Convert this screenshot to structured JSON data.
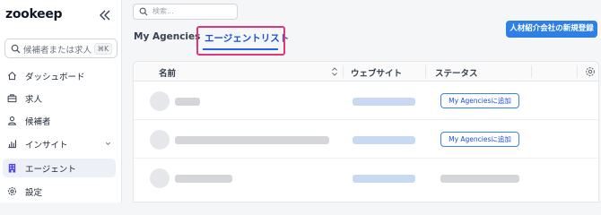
{
  "app": {
    "logo_text": "zookeep"
  },
  "sidebar": {
    "search_placeholder": "候補者または求人",
    "search_shortcut": "⌘K",
    "items": [
      {
        "label": "ダッシュボード",
        "icon": "home-icon"
      },
      {
        "label": "求人",
        "icon": "briefcase-icon"
      },
      {
        "label": "候補者",
        "icon": "person-icon"
      },
      {
        "label": "インサイト",
        "icon": "bar-chart-icon"
      },
      {
        "label": "エージェント",
        "icon": "building-icon",
        "active": true
      },
      {
        "label": "設定",
        "icon": "gear-icon"
      }
    ]
  },
  "main": {
    "search_placeholder": "検索...",
    "tabs": [
      {
        "label": "My Agencies"
      },
      {
        "label": "エージェントリスト",
        "active": true
      }
    ],
    "new_button_label": "人材紹介会社の新規登録",
    "table": {
      "headers": [
        "名前",
        "ウェブサイト",
        "ステータス"
      ],
      "rows": [
        {
          "action_label": "My Agenciesに追加"
        },
        {
          "action_label": "My Agenciesに追加"
        },
        {
          "action_label": ""
        }
      ]
    }
  },
  "colors": {
    "accent": "#2f80e4",
    "highlight": "#e0367a",
    "active_nav_bg": "#eef0f7"
  }
}
